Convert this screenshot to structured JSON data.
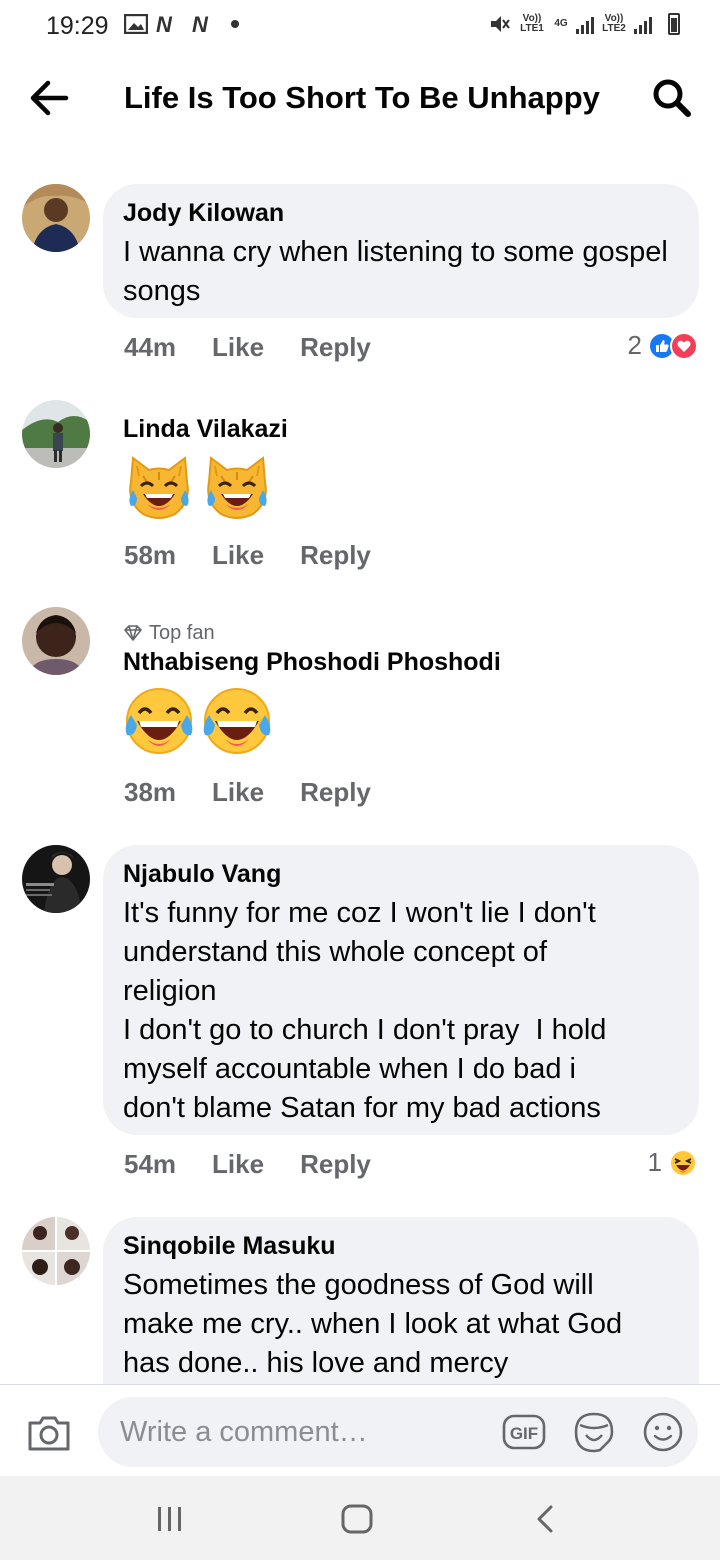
{
  "status_bar": {
    "time": "19:29",
    "net1_label": "Vo)) LTE1",
    "net_4g": "4G",
    "net2_label": "Vo)) LTE2"
  },
  "header": {
    "title": "Life Is Too Short To Be Unhappy"
  },
  "comments": [
    {
      "author": "Jody Kilowan",
      "text": "I wanna cry when listening to some gospel songs",
      "time": "44m",
      "like": "Like",
      "reply": "Reply",
      "reaction_count": "2",
      "reactions": [
        "like-icon",
        "love-icon"
      ]
    },
    {
      "author": "Linda Vilakazi",
      "emojis": [
        "cat-tears-of-joy-emoji",
        "cat-tears-of-joy-emoji"
      ],
      "time": "58m",
      "like": "Like",
      "reply": "Reply"
    },
    {
      "badge": "Top fan",
      "author": "Nthabiseng Phoshodi Phoshodi",
      "emojis": [
        "tears-of-joy-emoji",
        "tears-of-joy-emoji"
      ],
      "time": "38m",
      "like": "Like",
      "reply": "Reply"
    },
    {
      "author": "Njabulo Vang",
      "text_lines": [
        "It's funny for me coz I won't lie I don't",
        "understand this whole concept of",
        "religion",
        "I don't go to church I don't pray  I hold",
        "myself accountable when I do bad i",
        "don't blame Satan for my bad actions"
      ],
      "time": "54m",
      "like": "Like",
      "reply": "Reply",
      "reaction_count": "1",
      "reactions": [
        "haha-icon"
      ]
    },
    {
      "author": "Sinqobile Masuku",
      "text_lines": [
        "Sometimes the goodness of God will",
        "make me cry.. when I look at what God",
        "has done.. his love and mercy"
      ]
    }
  ],
  "composer": {
    "placeholder": "Write a comment…",
    "gif_label": "GIF"
  },
  "colors": {
    "bubble": "#f0f2f5",
    "like_blue": "#1877f2",
    "love_red": "#f33e58",
    "muted": "#65676b"
  }
}
